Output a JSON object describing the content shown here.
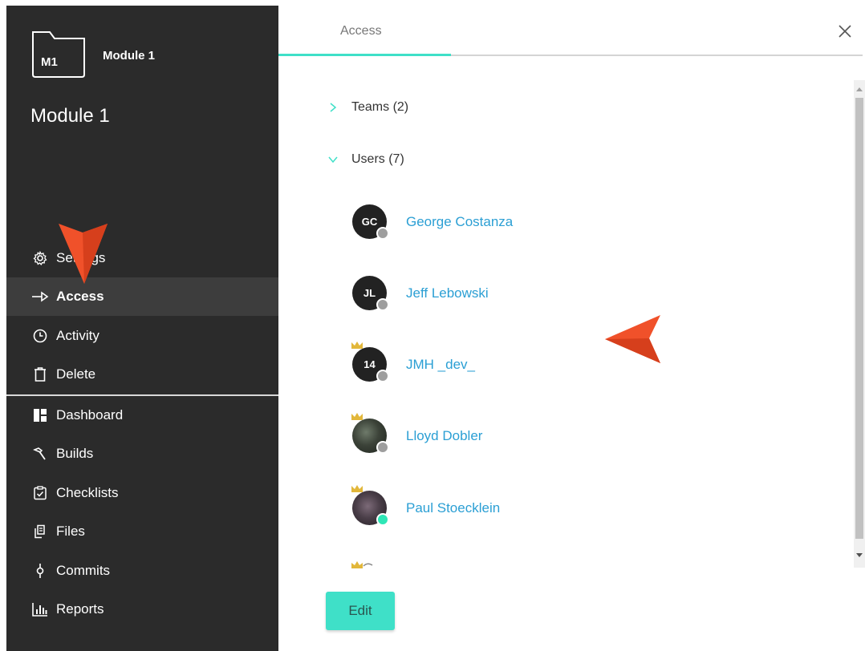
{
  "sidebar": {
    "module_badge": "M1",
    "module_label": "Module 1",
    "module_title": "Module 1",
    "items": [
      {
        "label": "Settings",
        "icon": "gear-icon"
      },
      {
        "label": "Access",
        "icon": "arrow-right-icon",
        "active": true
      },
      {
        "label": "Activity",
        "icon": "clock-icon"
      },
      {
        "label": "Delete",
        "icon": "trash-icon"
      },
      {
        "label": "Dashboard",
        "icon": "dashboard-icon"
      },
      {
        "label": "Builds",
        "icon": "hammer-icon"
      },
      {
        "label": "Checklists",
        "icon": "checklist-icon"
      },
      {
        "label": "Files",
        "icon": "files-icon"
      },
      {
        "label": "Commits",
        "icon": "commit-icon"
      },
      {
        "label": "Reports",
        "icon": "bar-chart-icon"
      }
    ]
  },
  "header": {
    "tab_label": "Access",
    "close_icon": "close-icon"
  },
  "sections": {
    "teams": {
      "label": "Teams (2)",
      "expanded": false
    },
    "users": {
      "label": "Users (7)",
      "expanded": true
    }
  },
  "users": [
    {
      "initials": "GC",
      "name": "George Costanza",
      "status": "offline",
      "crown": false
    },
    {
      "initials": "JL",
      "name": "Jeff Lebowski",
      "status": "offline",
      "crown": false
    },
    {
      "initials": "14",
      "name": "JMH _dev_",
      "status": "offline",
      "crown": true
    },
    {
      "initials": "",
      "name": "Lloyd Dobler",
      "status": "offline",
      "crown": true
    },
    {
      "initials": "",
      "name": "Paul Stoecklein",
      "status": "online",
      "crown": true
    }
  ],
  "actions": {
    "edit_label": "Edit"
  },
  "colors": {
    "accent": "#3fe0c8",
    "link": "#2b9fd4",
    "sidebar_bg": "#2b2b2b",
    "arrow": "#f0512a",
    "crown": "#e2b73a",
    "online": "#2ee6b6"
  }
}
